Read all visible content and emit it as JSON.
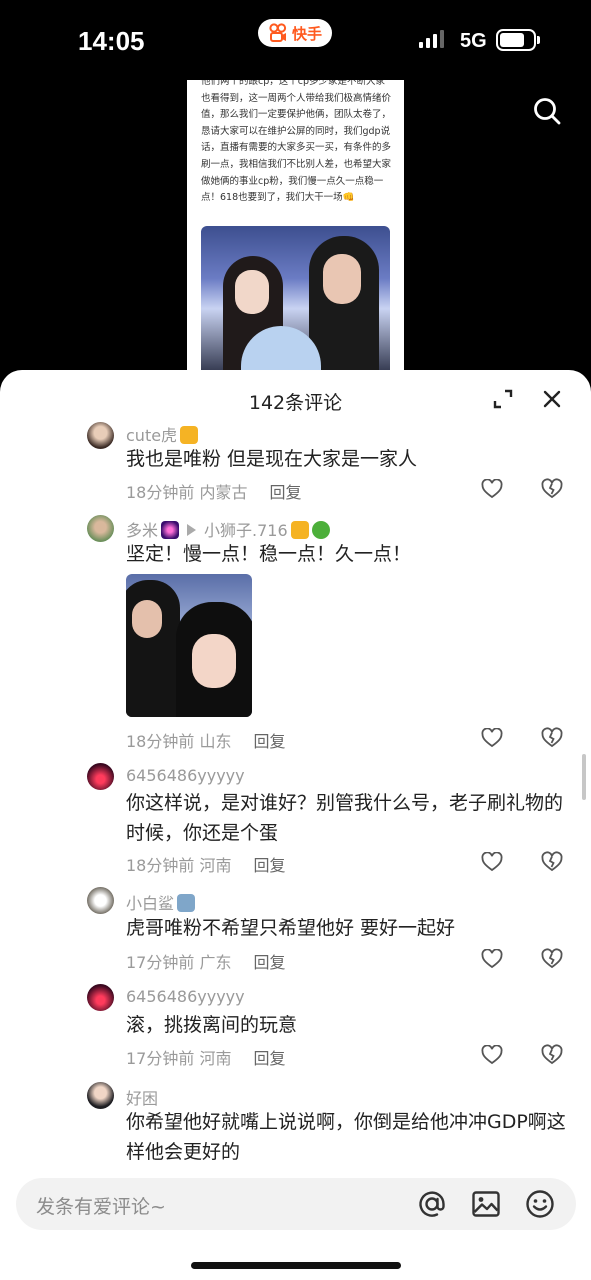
{
  "status_bar": {
    "time": "14:05",
    "app_name": "快手",
    "network": "5G",
    "battery_level": 0.75
  },
  "post": {
    "text": "他们两个的跟cp，这个cp多少家是不断大家也看得到，这一周两个人带给我们极高情绪价值，那么我们一定要保护他俩，团队太卷了，恳请大家可以在维护公屏的同时，我们gdp说话，直播有需要的大家多买一买，有条件的多刷一点，我相信我们不比别人差，也希望大家做她俩的事业cp粉，我们慢一点久一点稳一点！618也要到了，我们大干一场👊"
  },
  "comments_header": {
    "title": "142条评论"
  },
  "comments": [
    {
      "username": "cute虎",
      "text": "我也是唯粉 但是现在大家是一家人",
      "time": "18分钟前",
      "location": "内蒙古",
      "reply_label": "回复"
    },
    {
      "username": "多米",
      "reply_to": "小狮子.716",
      "text": "坚定！慢一点！稳一点！久一点！",
      "time": "18分钟前",
      "location": "山东",
      "reply_label": "回复"
    },
    {
      "username": "6456486yyyyy",
      "text": "你这样说，是对谁好？别管我什么号，老子刷礼物的时候，你还是个蛋",
      "time": "18分钟前",
      "location": "河南",
      "reply_label": "回复"
    },
    {
      "username": "小白鲨",
      "text": "虎哥唯粉不希望只希望他好 要好一起好",
      "time": "17分钟前",
      "location": "广东",
      "reply_label": "回复"
    },
    {
      "username": "6456486yyyyy",
      "text": "滚，挑拨离间的玩意",
      "time": "17分钟前",
      "location": "河南",
      "reply_label": "回复"
    },
    {
      "username": "好困",
      "text": "你希望他好就嘴上说说啊，你倒是给他冲冲GDP啊这样他会更好的"
    }
  ],
  "input_bar": {
    "placeholder": "发条有爱评论~"
  },
  "colors": {
    "brand": "#ff5a1f",
    "meta_text": "#9a9a9a"
  }
}
